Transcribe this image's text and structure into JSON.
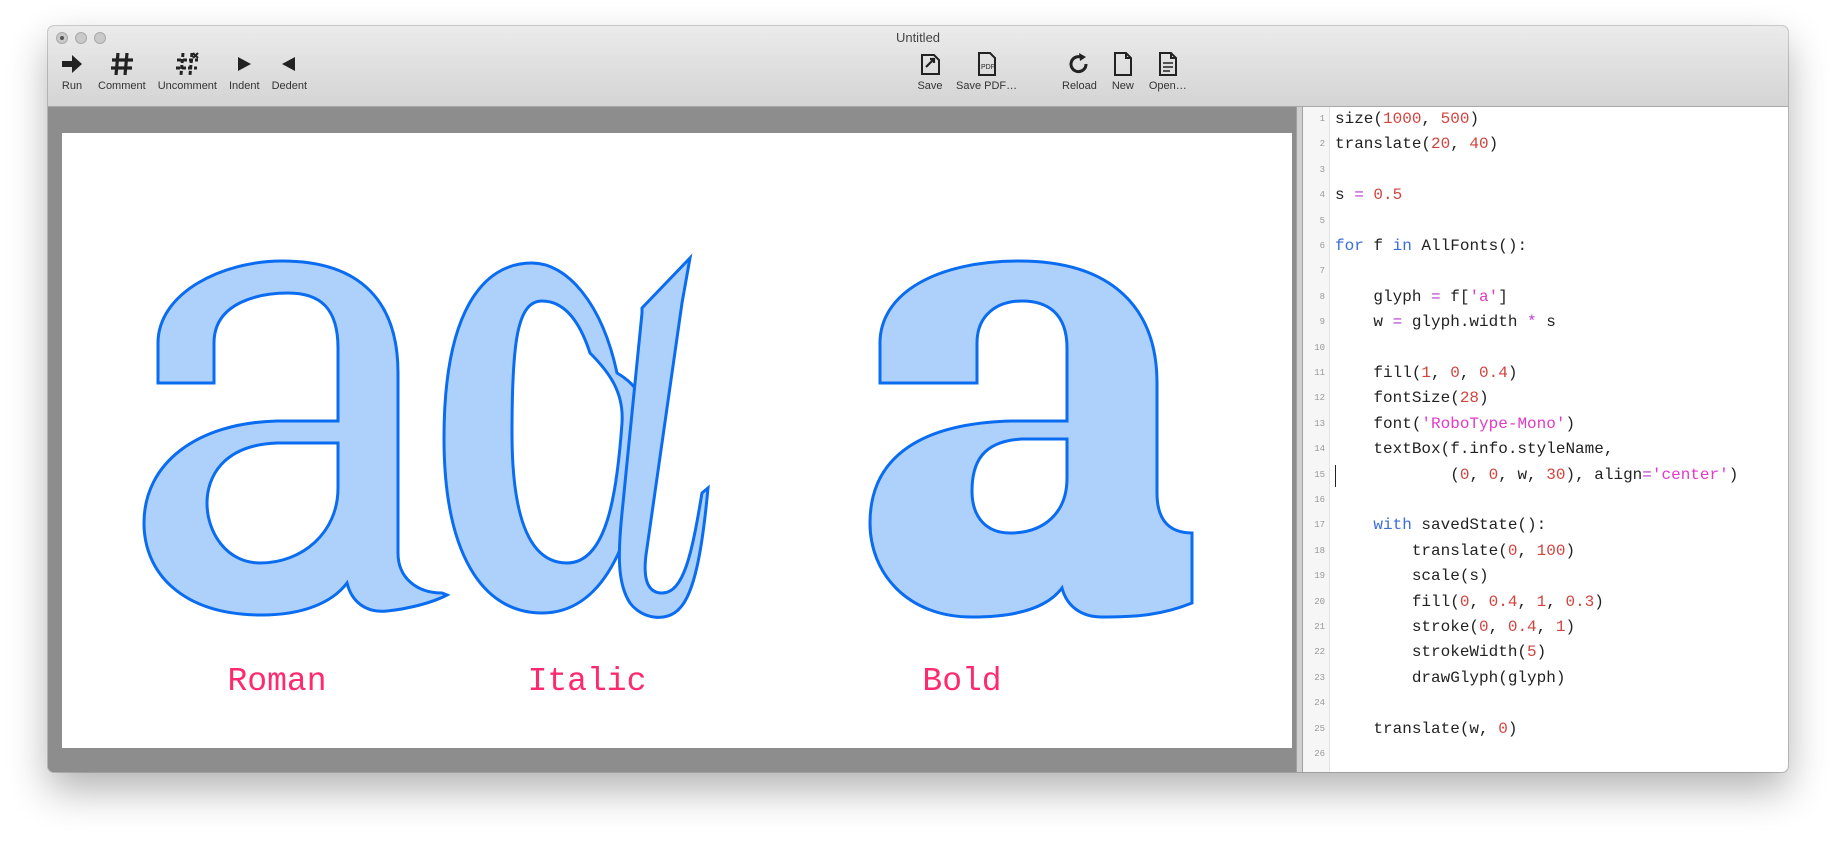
{
  "window": {
    "title": "Untitled"
  },
  "toolbar": {
    "left": [
      {
        "label": "Run",
        "icon": "run-arrow-icon"
      },
      {
        "label": "Comment",
        "icon": "hash-icon"
      },
      {
        "label": "Uncomment",
        "icon": "uncomment-hash-icon"
      },
      {
        "label": "Indent",
        "icon": "indent-triangle-icon"
      },
      {
        "label": "Dedent",
        "icon": "dedent-triangle-icon"
      }
    ],
    "center": [
      {
        "label": "Save",
        "icon": "save-icon"
      },
      {
        "label": "Save PDF…",
        "icon": "pdf-document-icon"
      }
    ],
    "right": [
      {
        "label": "Reload",
        "icon": "reload-icon"
      },
      {
        "label": "New",
        "icon": "new-document-icon"
      },
      {
        "label": "Open…",
        "icon": "open-document-icon"
      }
    ]
  },
  "canvas": {
    "labels": [
      "Roman",
      "Italic",
      "Bold"
    ],
    "glyph_fill": "#aed1fc",
    "glyph_stroke": "#0a6cf0",
    "label_color": "#ff2a6e"
  },
  "editor": {
    "lines": [
      "size(1000, 500)",
      "translate(20, 40)",
      "",
      "s = 0.5",
      "",
      "for f in AllFonts():",
      "",
      "    glyph = f['a']",
      "    w = glyph.width * s",
      "",
      "    fill(1, 0, 0.4)",
      "    fontSize(28)",
      "    font('RoboType-Mono')",
      "    textBox(f.info.styleName,",
      "            (0, 0, w, 30), align='center')",
      "",
      "    with savedState():",
      "        translate(0, 100)",
      "        scale(s)",
      "        fill(0, 0.4, 1, 0.3)",
      "        stroke(0, 0.4, 1)",
      "        strokeWidth(5)",
      "        drawGlyph(glyph)",
      "",
      "    translate(w, 0)",
      ""
    ],
    "cursor_line": 15
  }
}
